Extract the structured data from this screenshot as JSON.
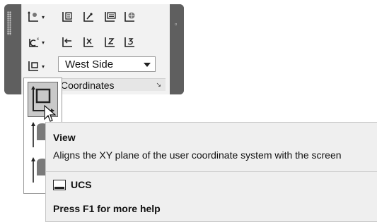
{
  "panel": {
    "title": "Coordinates",
    "row1_icons": [
      "ucs-origin-icon",
      "ucs-object-icon",
      "ucs-3point-icon",
      "ucs-face-icon",
      "ucs-world-icon"
    ],
    "row2_icons": [
      "ucs-named-icon",
      "ucs-previous-icon",
      "ucs-x-icon",
      "ucs-z-icon",
      "ucs-3d-icon"
    ],
    "view_dropdown": {
      "selected": "West Side"
    }
  },
  "tooltip": {
    "title": "View",
    "description": "Aligns the XY plane of the user coordinate system with the screen",
    "command_label": "UCS",
    "help_hint": "Press F1 for more help"
  }
}
